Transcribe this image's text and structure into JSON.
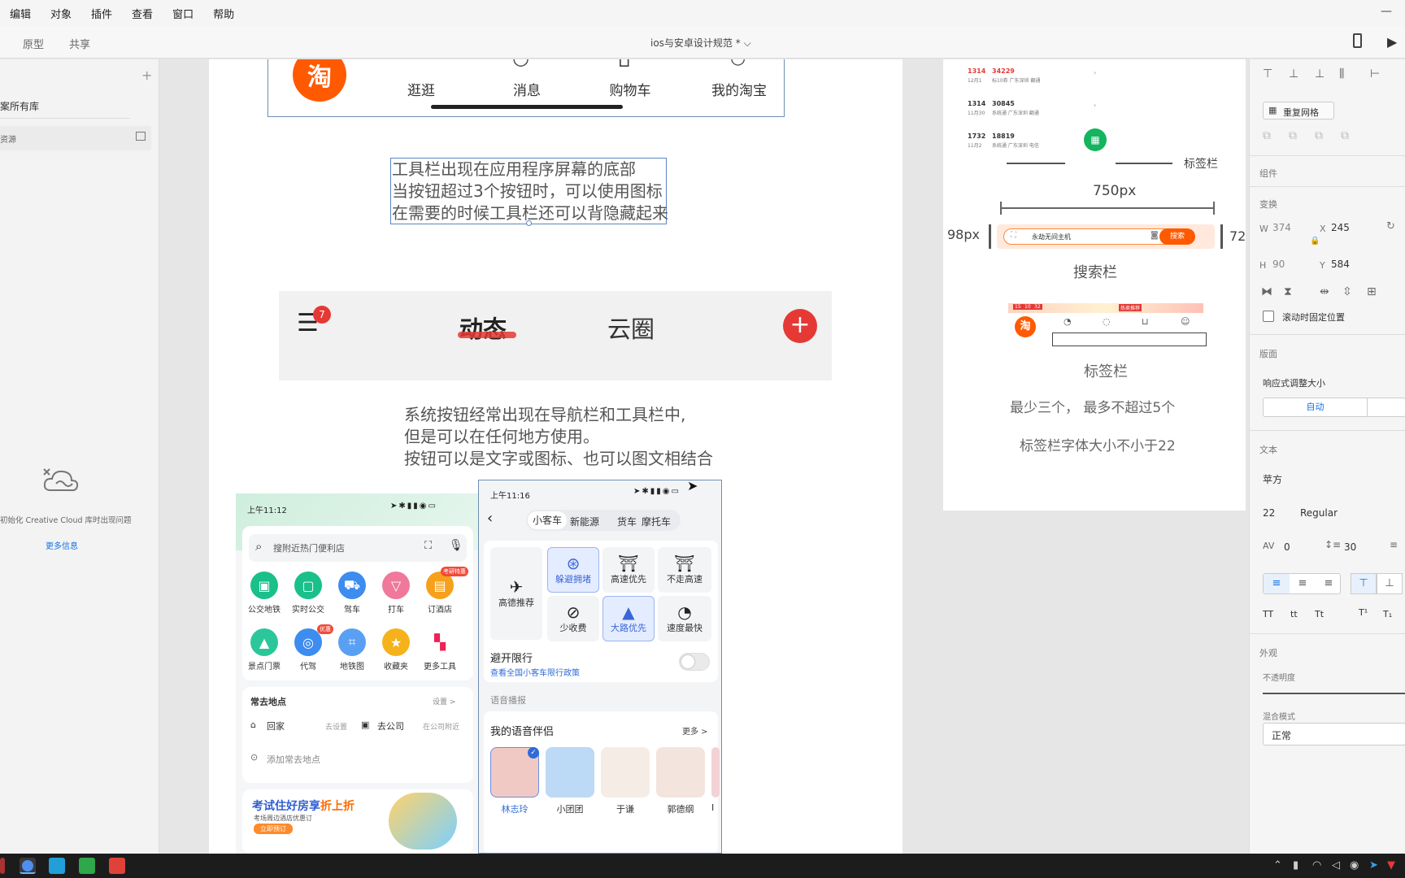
{
  "menu": [
    "编辑",
    "对象",
    "插件",
    "查看",
    "窗口",
    "帮助"
  ],
  "window_min": "—",
  "modes": [
    "原型",
    "共享"
  ],
  "doc_title": "ios与安卓设计规范 *",
  "left": {
    "add": "+",
    "lib_title": "案所有库",
    "lib_sub": "资源",
    "cc_msg": "初始化 Creative Cloud 库时出现问题",
    "more": "更多信息"
  },
  "canvas": {
    "tabbar_items": [
      "逛逛",
      "消息",
      "购物车",
      "我的淘宝"
    ],
    "taobao": "淘",
    "toolbar_note": [
      "工具栏出现在应用程序屏幕的底部",
      "当按钮超过3个按钮时，可以使用图标",
      "在需要的时候工具栏还可以背隐藏起来"
    ],
    "nav_badge": "7",
    "nav_tabs": [
      "动态",
      "云圈"
    ],
    "plus": "+",
    "sys_note": [
      "系统按钮经常出现在导航栏和工具栏中,",
      "但是可以在任何地方使用。",
      "按钮可以是文字或图标、也可以图文相结合"
    ],
    "phone1": {
      "time": "上午11:12",
      "search_placeholder": "搜附近热门便利店",
      "row1": [
        "公交地铁",
        "实时公交",
        "驾车",
        "打车",
        "订酒店"
      ],
      "row1_badge": "考研特惠",
      "row2": [
        "景点门票",
        "代驾",
        "地铁图",
        "收藏夹",
        "更多工具"
      ],
      "row2_badge": "优惠",
      "frequent": "常去地点",
      "settings": "设置 >",
      "home": "回家",
      "home_hint": "去设置",
      "work": "去公司",
      "work_hint": "在公司附近",
      "add_place": "添加常去地点",
      "promo_title": "考试住好房享",
      "promo_hl": "折上折",
      "promo_sub": "考场周边酒店优惠订",
      "promo_btn": "立即预订"
    },
    "phone2": {
      "time": "上午11:16",
      "tabs": [
        "小客车",
        "新能源",
        "货车",
        "摩托车"
      ],
      "options": [
        "高德推荐",
        "躲避拥堵",
        "高速优先",
        "不走高速",
        "少收费",
        "大路优先",
        "速度最快"
      ],
      "avoid": "避开限行",
      "avoid_link": "查看全国小客车限行政策",
      "voice": "语音播报",
      "companion": "我的语音伴侣",
      "more": "更多 >",
      "voices": [
        "林志玲",
        "小团团",
        "于谦",
        "郭德纲",
        "I"
      ]
    },
    "right_board": {
      "rows": [
        {
          "num": "1314",
          "code": "34229",
          "date": "12月1",
          "desc": "标10券 广东深圳 翻通"
        },
        {
          "num": "1314",
          "code": "30845",
          "date": "11月30",
          "desc": "系统通 广东深圳 翻通"
        },
        {
          "num": "1732",
          "code": "18819",
          "date": "11月2",
          "desc": "系统通 广东深圳 电信"
        }
      ],
      "tag_label": "标签栏",
      "width_label": "750px",
      "h98": "98px",
      "h72": "72",
      "search_text": "永劫无间主机",
      "search_btn": "搜索",
      "search_label": "搜索栏",
      "tag_caption": "标签栏",
      "rule1": "最少三个， 最多不超过5个",
      "rule2": "标签栏字体大小不小于22",
      "mini_badges": [
        "15",
        "10",
        "32"
      ],
      "mini_tag": "热卖推荐"
    }
  },
  "inspector": {
    "repeat_grid": "重复网格",
    "component": "组件",
    "transform": "变换",
    "w_label": "W",
    "w": "374",
    "x_label": "X",
    "x": "245",
    "h_label": "H",
    "h": "90",
    "y_label": "Y",
    "y": "584",
    "fix_scroll": "滚动时固定位置",
    "layout": "版面",
    "responsive": "响应式调整大小",
    "auto": "自动",
    "text": "文本",
    "font": "苹方",
    "size": "22",
    "weight": "Regular",
    "tracking": "0",
    "line_height": "30",
    "case": [
      "TT",
      "tt",
      "Tt"
    ],
    "appearance": "外观",
    "opacity": "不透明度",
    "blend": "混合模式",
    "blend_value": "正常"
  },
  "colors": {
    "accent": "#1473e6",
    "red": "#e53935",
    "orange": "#ff6a00",
    "green": "#15b45f"
  }
}
